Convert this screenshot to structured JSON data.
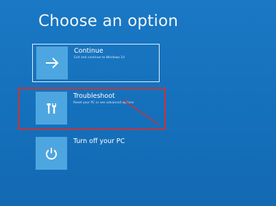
{
  "screen": {
    "title": "Choose an option"
  },
  "options": [
    {
      "label": "Continue",
      "description": "Exit and continue to Windows 10",
      "icon": "arrow-right-icon"
    },
    {
      "label": "Troubleshoot",
      "description": "Reset your PC or see advanced options",
      "icon": "tools-icon"
    },
    {
      "label": "Turn off your PC",
      "description": "",
      "icon": "power-icon"
    }
  ],
  "colors": {
    "background": "#1570bb",
    "tile": "#4ea6e0",
    "annotation": "#d1312f"
  }
}
